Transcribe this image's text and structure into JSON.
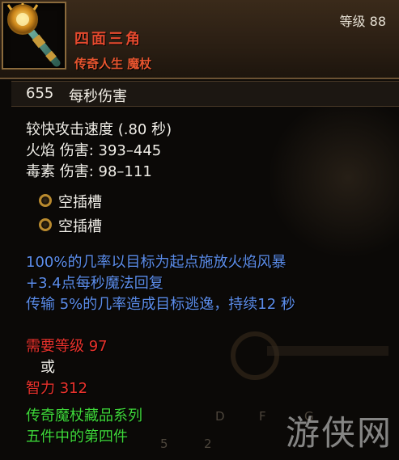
{
  "item": {
    "icon": "scepter-icon",
    "name": "四面三角",
    "type": "传奇人生 魔杖",
    "level_req": "等级 88"
  },
  "dps": {
    "value": "655",
    "label": "每秒伤害"
  },
  "stats": {
    "attack_speed": "较快攻击速度 (.80 秒)",
    "fire_damage": "火焰 伤害: 393–445",
    "poison_damage": "毒素 伤害: 98–111"
  },
  "sockets": [
    {
      "label": "空插槽"
    },
    {
      "label": "空插槽"
    }
  ],
  "affixes": [
    "100%的几率以目标为起点施放火焰风暴",
    "+3.4点每秒魔法回复",
    "传输 5%的几率造成目标逃逸，持续12 秒"
  ],
  "requirements": {
    "level": "需要等级 97",
    "or": "或",
    "intelligence": "智力 312"
  },
  "set": {
    "name": "传奇魔杖藏品系列",
    "piece": "五件中的第四件"
  },
  "background": {
    "hotkeys": [
      "D",
      "F",
      "G"
    ],
    "counts": [
      "5",
      "2"
    ]
  },
  "watermark": "游侠网",
  "colors": {
    "item_name": "#e64a2e",
    "magic_affix": "#5c8dea",
    "requirement": "#e8322c",
    "set_text": "#3fd93a",
    "socket_ring": "#b98a2e"
  }
}
